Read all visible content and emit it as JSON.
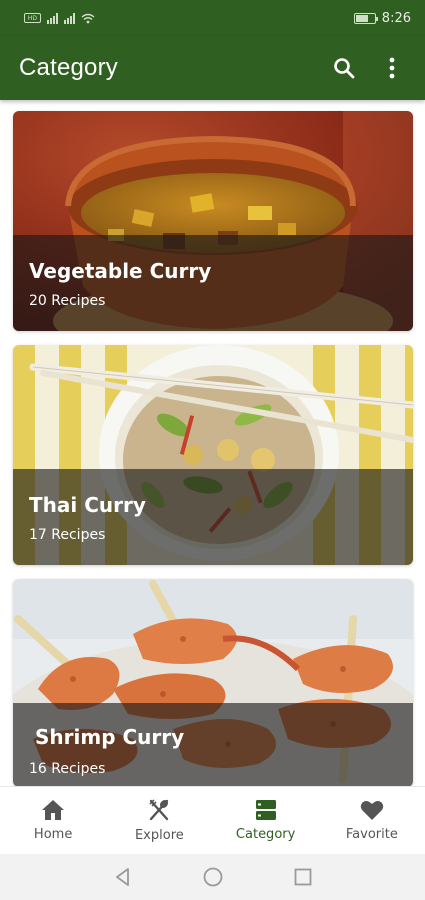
{
  "status_bar": {
    "time": "8:26",
    "sim_label": "HD",
    "battery_level_percent": 70
  },
  "app_bar": {
    "title": "Category",
    "actions": [
      {
        "icon": "search-icon"
      },
      {
        "icon": "more-vert-icon"
      }
    ]
  },
  "categories": [
    {
      "title": "Vegetable Curry",
      "subtitle": "20 Recipes"
    },
    {
      "title": "Thai Curry",
      "subtitle": "17 Recipes"
    },
    {
      "title": "Shrimp Curry",
      "subtitle": "16 Recipes"
    }
  ],
  "bottom_nav": {
    "active_index": 2,
    "items": [
      {
        "label": "Home",
        "icon": "home-icon"
      },
      {
        "label": "Explore",
        "icon": "utensils-icon"
      },
      {
        "label": "Category",
        "icon": "category-icon"
      },
      {
        "label": "Favorite",
        "icon": "heart-icon"
      }
    ]
  },
  "colors": {
    "primary": "#2f5f21",
    "nav_inactive": "#555555"
  }
}
